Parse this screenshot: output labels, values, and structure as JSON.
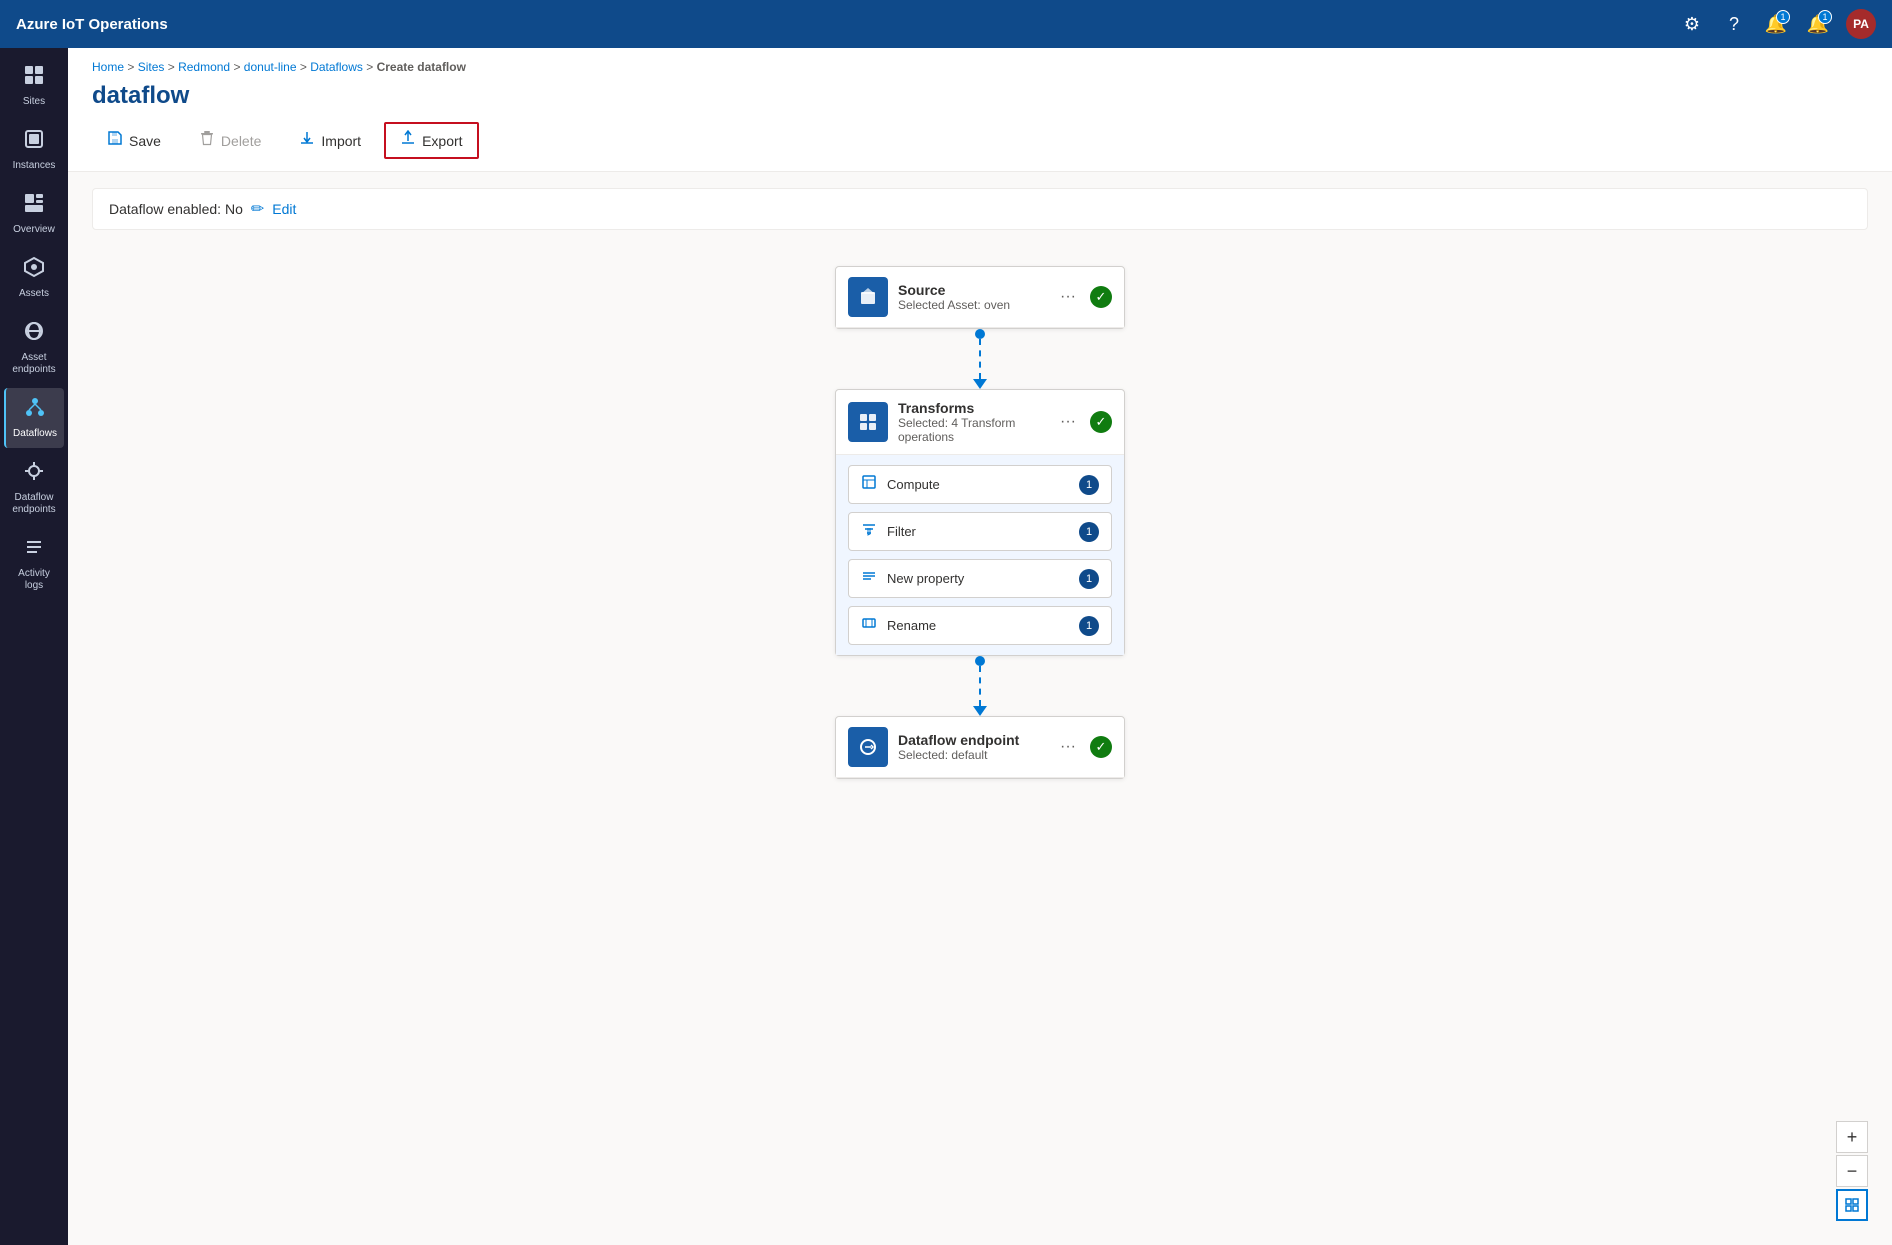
{
  "app": {
    "title": "Azure IoT Operations"
  },
  "topnav": {
    "title": "Azure IoT Operations",
    "icons": {
      "gear": "⚙",
      "help": "?",
      "bell1": "🔔",
      "bell2": "🔔"
    },
    "bell1_badge": "1",
    "bell2_badge": "1",
    "avatar": "PA"
  },
  "sidebar": {
    "items": [
      {
        "id": "sites",
        "label": "Sites",
        "icon": "⊞"
      },
      {
        "id": "instances",
        "label": "Instances",
        "icon": "⬛"
      },
      {
        "id": "overview",
        "label": "Overview",
        "icon": "▦"
      },
      {
        "id": "assets",
        "label": "Assets",
        "icon": "◈"
      },
      {
        "id": "asset-endpoints",
        "label": "Asset endpoints",
        "icon": "⬡"
      },
      {
        "id": "dataflows",
        "label": "Dataflows",
        "icon": "⟲",
        "active": true
      },
      {
        "id": "dataflow-endpoints",
        "label": "Dataflow endpoints",
        "icon": "⊕"
      },
      {
        "id": "activity-logs",
        "label": "Activity logs",
        "icon": "≡"
      }
    ]
  },
  "breadcrumb": {
    "parts": [
      "Home",
      "Sites",
      "Redmond",
      "donut-line",
      "Dataflows",
      "Create dataflow"
    ],
    "separators": [
      ">",
      ">",
      ">",
      ">",
      ">"
    ]
  },
  "page_title": "dataflow",
  "toolbar": {
    "save_label": "Save",
    "delete_label": "Delete",
    "import_label": "Import",
    "export_label": "Export"
  },
  "enabled_bar": {
    "status_text": "Dataflow enabled: No",
    "edit_label": "Edit"
  },
  "flow": {
    "source": {
      "title": "Source",
      "subtitle": "Selected Asset: oven",
      "icon": "📦"
    },
    "transforms": {
      "title": "Transforms",
      "subtitle": "Selected: 4 Transform operations",
      "icon": "⊞",
      "operations": [
        {
          "label": "Compute",
          "badge": "1",
          "icon": "⊟"
        },
        {
          "label": "Filter",
          "badge": "1",
          "icon": "⇌"
        },
        {
          "label": "New property",
          "badge": "1",
          "icon": "≡"
        },
        {
          "label": "Rename",
          "badge": "1",
          "icon": "⊠"
        }
      ]
    },
    "endpoint": {
      "title": "Dataflow endpoint",
      "subtitle": "Selected: default",
      "icon": "⟳"
    }
  },
  "zoom": {
    "plus": "+",
    "minus": "−",
    "fit": "⊡"
  }
}
